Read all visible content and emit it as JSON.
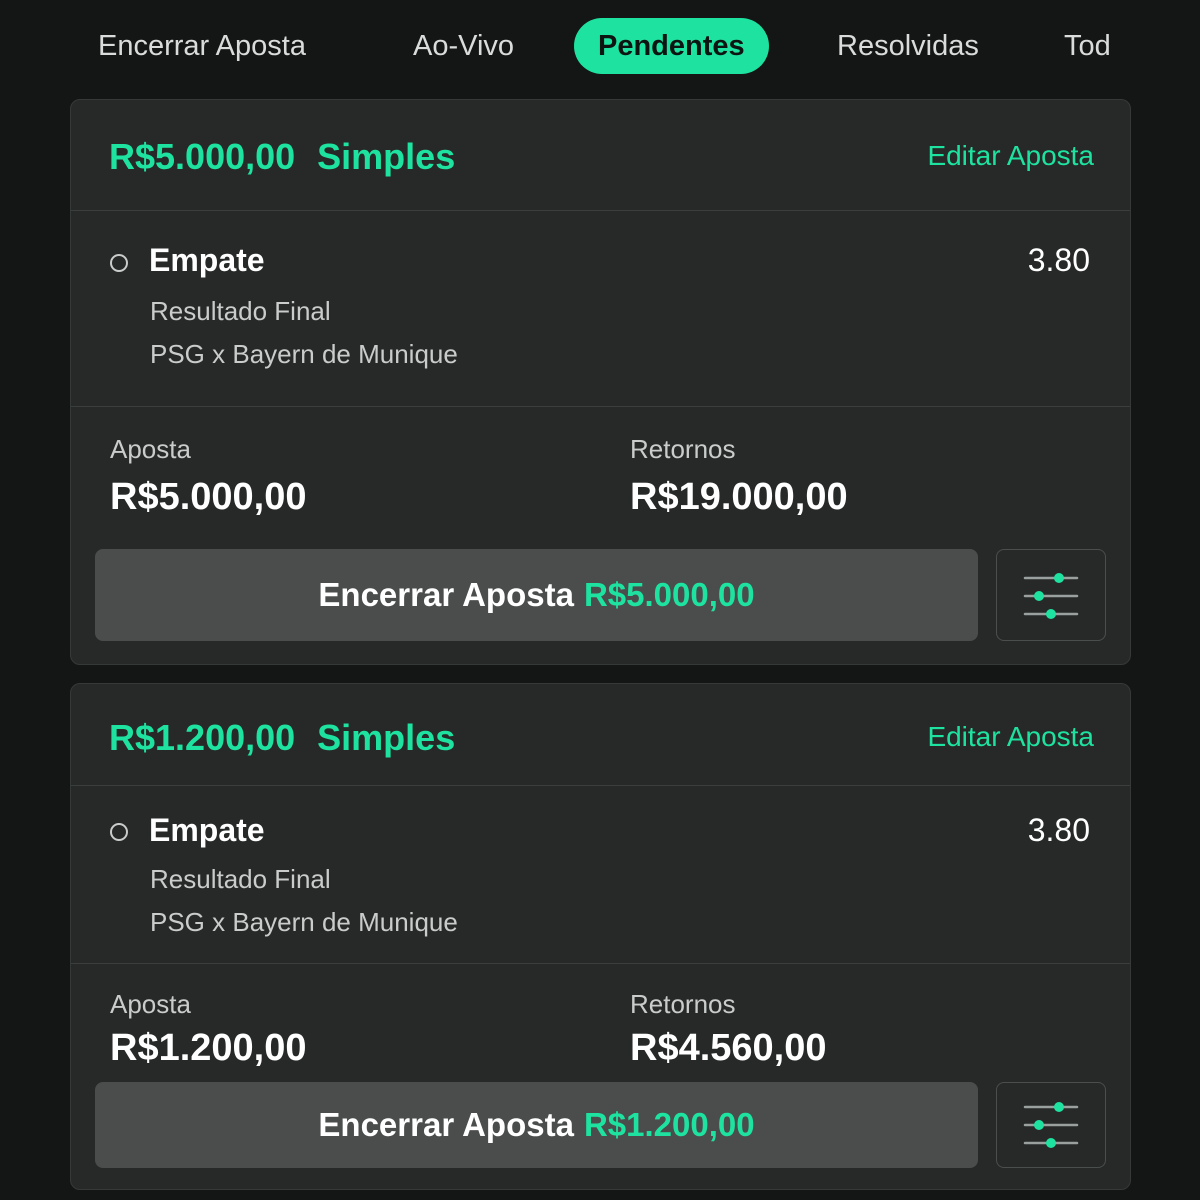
{
  "tabs": [
    {
      "label": "Encerrar Aposta",
      "active": false
    },
    {
      "label": "Ao-Vivo",
      "active": false
    },
    {
      "label": "Pendentes",
      "active": true
    },
    {
      "label": "Resolvidas",
      "active": false
    },
    {
      "label": "Tod",
      "active": false
    }
  ],
  "bets": [
    {
      "stake_label": "R$5.000,00",
      "type_label": "Simples",
      "edit_label": "Editar Aposta",
      "selection": "Empate",
      "odds": "3.80",
      "market": "Resultado Final",
      "event": "PSG x Bayern de Munique",
      "stake_caption": "Aposta",
      "stake_value": "R$5.000,00",
      "returns_caption": "Retornos",
      "returns_value": "R$19.000,00",
      "cashout_label": "Encerrar Aposta",
      "cashout_value": "R$5.000,00",
      "settings_icon": "sliders-icon"
    },
    {
      "stake_label": "R$1.200,00",
      "type_label": "Simples",
      "edit_label": "Editar Aposta",
      "selection": "Empate",
      "odds": "3.80",
      "market": "Resultado Final",
      "event": "PSG x Bayern de Munique",
      "stake_caption": "Aposta",
      "stake_value": "R$1.200,00",
      "returns_caption": "Retornos",
      "returns_value": "R$4.560,00",
      "cashout_label": "Encerrar Aposta",
      "cashout_value": "R$1.200,00",
      "settings_icon": "sliders-icon"
    }
  ],
  "colors": {
    "accent": "#1ee3a0",
    "background": "#141615",
    "card": "#262928",
    "button": "#4a4d4c"
  }
}
